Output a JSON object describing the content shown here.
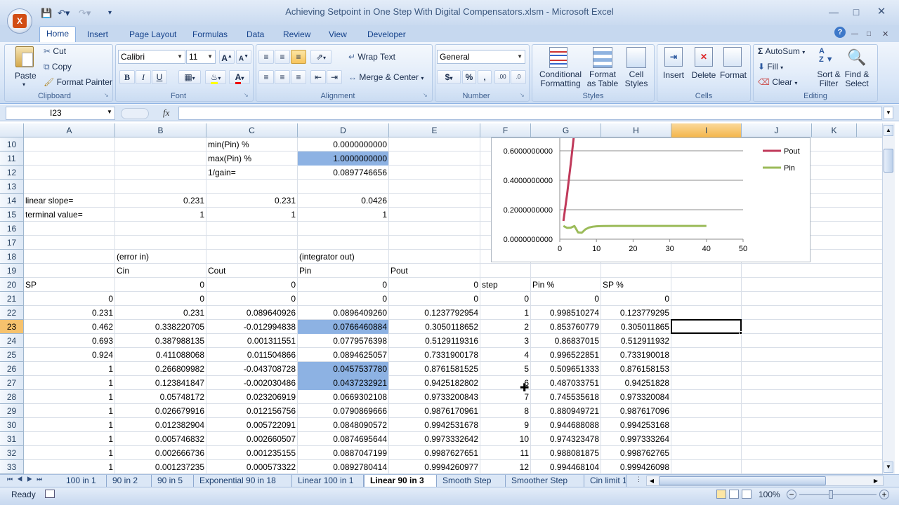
{
  "window": {
    "title": "Achieving Setpoint in One Step With Digital Compensators.xlsm - Microsoft Excel",
    "logo_text": "X"
  },
  "ribbon_tabs": [
    "Home",
    "Insert",
    "Page Layout",
    "Formulas",
    "Data",
    "Review",
    "View",
    "Developer"
  ],
  "clipboard": {
    "paste": "Paste",
    "cut": "Cut",
    "copy": "Copy",
    "format_painter": "Format Painter",
    "label": "Clipboard"
  },
  "font": {
    "name": "Calibri",
    "size": "11",
    "label": "Font",
    "bold": "B",
    "italic": "I",
    "underline": "U"
  },
  "alignment": {
    "wrap": "Wrap Text",
    "merge": "Merge & Center",
    "label": "Alignment"
  },
  "number": {
    "format": "General",
    "currency": "$",
    "percent": "%",
    "comma": ",",
    "label": "Number"
  },
  "styles": {
    "conditional": "Conditional Formatting",
    "format_table": "Format as Table",
    "cell_styles": "Cell Styles",
    "label": "Styles"
  },
  "cells": {
    "insert": "Insert",
    "delete": "Delete",
    "format": "Format",
    "label": "Cells"
  },
  "editing": {
    "autosum": "AutoSum",
    "fill": "Fill",
    "clear": "Clear",
    "sort": "Sort & Filter",
    "find": "Find & Select",
    "label": "Editing"
  },
  "formula_bar": {
    "name_box": "I23",
    "fx": "fx",
    "value": ""
  },
  "columns": [
    "A",
    "B",
    "C",
    "D",
    "E",
    "F",
    "G",
    "H",
    "I",
    "J",
    "K"
  ],
  "rows": [
    {
      "n": "10",
      "cells": [
        "",
        "",
        "min(Pin) %",
        "0.0000000000",
        "",
        "",
        "",
        "",
        ""
      ]
    },
    {
      "n": "11",
      "cells": [
        "",
        "",
        "max(Pin) %",
        "1.0000000000",
        "",
        "",
        "",
        "",
        ""
      ]
    },
    {
      "n": "12",
      "cells": [
        "",
        "",
        "1/gain=",
        "0.0897746656",
        "",
        "",
        "",
        "",
        ""
      ]
    },
    {
      "n": "13",
      "cells": [
        "",
        "",
        "",
        "",
        "",
        "",
        "",
        "",
        ""
      ]
    },
    {
      "n": "14",
      "cells": [
        "linear slope=",
        "0.231",
        "0.231",
        "0.0426",
        "",
        "",
        "",
        "",
        ""
      ]
    },
    {
      "n": "15",
      "cells": [
        "terminal value=",
        "1",
        "1",
        "1",
        "",
        "",
        "",
        "",
        ""
      ]
    },
    {
      "n": "16",
      "cells": [
        "",
        "",
        "",
        "",
        "",
        "",
        "",
        "",
        ""
      ]
    },
    {
      "n": "17",
      "cells": [
        "",
        "",
        "",
        "",
        "",
        "",
        "",
        "",
        ""
      ]
    },
    {
      "n": "18",
      "cells": [
        "",
        "(error in)",
        "",
        "(integrator out)",
        "",
        "",
        "",
        "",
        ""
      ]
    },
    {
      "n": "19",
      "cells": [
        "",
        "Cin",
        "Cout",
        "Pin",
        "Pout",
        "",
        "",
        "",
        ""
      ]
    },
    {
      "n": "20",
      "cells": [
        "SP",
        "0",
        "0",
        "0",
        "0",
        "step",
        "Pin %",
        "SP %",
        ""
      ]
    },
    {
      "n": "21",
      "cells": [
        "0",
        "0",
        "0",
        "0",
        "0",
        "0",
        "0",
        "0",
        ""
      ]
    },
    {
      "n": "22",
      "cells": [
        "0.231",
        "0.231",
        "0.089640926",
        "0.0896409260",
        "0.1237792954",
        "1",
        "0.998510274",
        "0.123779295",
        ""
      ]
    },
    {
      "n": "23",
      "cells": [
        "0.462",
        "0.338220705",
        "-0.012994838",
        "0.0766460884",
        "0.3050118652",
        "2",
        "0.853760779",
        "0.305011865",
        ""
      ]
    },
    {
      "n": "24",
      "cells": [
        "0.693",
        "0.387988135",
        "0.001311551",
        "0.0779576398",
        "0.5129119316",
        "3",
        "0.86837015",
        "0.512911932",
        ""
      ]
    },
    {
      "n": "25",
      "cells": [
        "0.924",
        "0.411088068",
        "0.011504866",
        "0.0894625057",
        "0.7331900178",
        "4",
        "0.996522851",
        "0.733190018",
        ""
      ]
    },
    {
      "n": "26",
      "cells": [
        "1",
        "0.266809982",
        "-0.043708728",
        "0.0457537780",
        "0.8761581525",
        "5",
        "0.509651333",
        "0.876158153",
        ""
      ]
    },
    {
      "n": "27",
      "cells": [
        "1",
        "0.123841847",
        "-0.002030486",
        "0.0437232921",
        "0.9425182802",
        "6",
        "0.487033751",
        "0.94251828",
        ""
      ]
    },
    {
      "n": "28",
      "cells": [
        "1",
        "0.05748172",
        "0.023206919",
        "0.0669302108",
        "0.9733200843",
        "7",
        "0.745535618",
        "0.973320084",
        ""
      ]
    },
    {
      "n": "29",
      "cells": [
        "1",
        "0.026679916",
        "0.012156756",
        "0.0790869666",
        "0.9876170961",
        "8",
        "0.880949721",
        "0.987617096",
        ""
      ]
    },
    {
      "n": "30",
      "cells": [
        "1",
        "0.012382904",
        "0.005722091",
        "0.0848090572",
        "0.9942531678",
        "9",
        "0.944688088",
        "0.994253168",
        ""
      ]
    },
    {
      "n": "31",
      "cells": [
        "1",
        "0.005746832",
        "0.002660507",
        "0.0874695644",
        "0.9973332642",
        "10",
        "0.974323478",
        "0.997333264",
        ""
      ]
    },
    {
      "n": "32",
      "cells": [
        "1",
        "0.002666736",
        "0.001235155",
        "0.0887047199",
        "0.9987627651",
        "11",
        "0.988081875",
        "0.998762765",
        ""
      ]
    },
    {
      "n": "33",
      "cells": [
        "1",
        "0.001237235",
        "0.000573322",
        "0.0892780414",
        "0.9994260977",
        "12",
        "0.994468104",
        "0.999426098",
        ""
      ]
    }
  ],
  "highlight": {
    "D11": true,
    "D23": true,
    "D26": true,
    "D27": true
  },
  "chart_data": {
    "type": "line",
    "y_ticks": [
      "0.0000000000",
      "0.2000000000",
      "0.4000000000",
      "0.6000000000"
    ],
    "x_ticks": [
      "0",
      "10",
      "20",
      "30",
      "40",
      "50"
    ],
    "xlim": [
      0,
      50
    ],
    "ylim": [
      0,
      0.7
    ],
    "legend_placement": "top-right",
    "series": [
      {
        "name": "Pout",
        "color": "#c0395a",
        "x": [
          1,
          2,
          3,
          4
        ],
        "y": [
          0.1238,
          0.305,
          0.5129,
          0.7332
        ]
      },
      {
        "name": "Pin",
        "color": "#9bbb59",
        "x": [
          1,
          2,
          3,
          4,
          5,
          6,
          7,
          8,
          9,
          10,
          11,
          12,
          15,
          20,
          25,
          30,
          35,
          40
        ],
        "y": [
          0.0896,
          0.0766,
          0.078,
          0.0895,
          0.0458,
          0.0437,
          0.0669,
          0.0791,
          0.0848,
          0.0875,
          0.0887,
          0.0893,
          0.0897,
          0.0898,
          0.0898,
          0.0898,
          0.0898,
          0.0898
        ]
      }
    ]
  },
  "sheet_tabs": [
    "100 in 1",
    "90 in 2",
    "90 in 5",
    "Exponential 90 in 18",
    "Linear 100 in 1",
    "Linear 90 in 3",
    "Smooth Step",
    "Smoother Step",
    "Cin limit 1"
  ],
  "active_sheet": "Linear 90 in 3",
  "status": {
    "ready": "Ready",
    "zoom": "100%"
  }
}
